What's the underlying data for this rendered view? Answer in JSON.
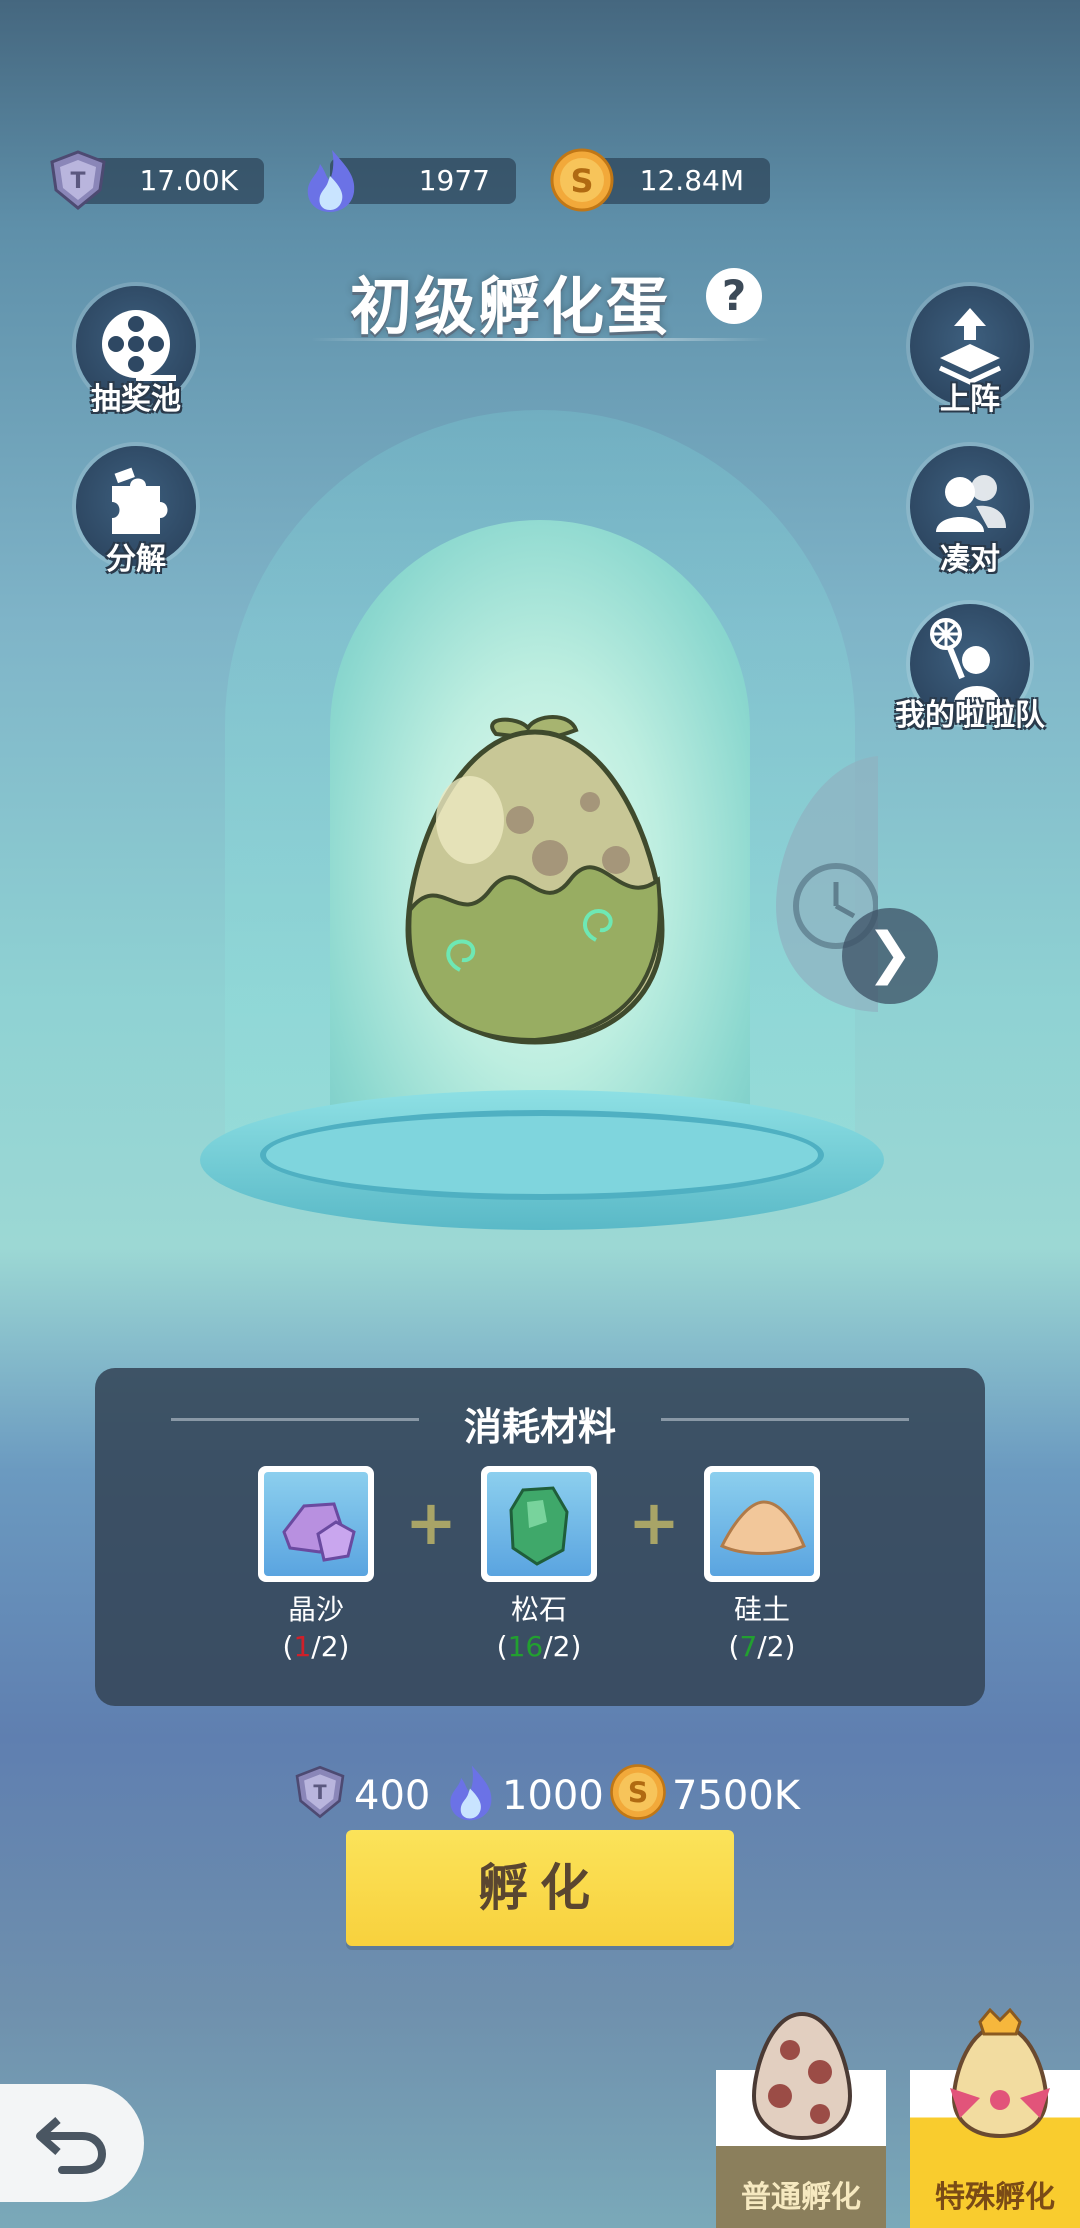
{
  "resources": {
    "gems": "17.00K",
    "fire": "1977",
    "coins": "12.84M"
  },
  "title": "初级孵化蛋",
  "help_symbol": "?",
  "side_buttons": {
    "left": [
      "抽奖池",
      "分解"
    ],
    "right": [
      "上阵",
      "凑对",
      "我的啦啦队"
    ]
  },
  "materials": {
    "title": "消耗材料",
    "items": [
      {
        "name": "晶沙",
        "have": "1",
        "need": "/2)",
        "open": "(",
        "have_color": "#d0202a"
      },
      {
        "name": "松石",
        "have": "16",
        "need": "/2)",
        "open": "(",
        "have_color": "#22a030"
      },
      {
        "name": "硅土",
        "have": "7",
        "need": "/2)",
        "open": "(",
        "have_color": "#22a030"
      }
    ],
    "plus": "+"
  },
  "cost": {
    "gems": "400",
    "fire": "1000",
    "coins": "7500K"
  },
  "hatch_button": "孵化",
  "tabs": {
    "normal": "普通孵化",
    "special": "特殊孵化"
  },
  "colors": {
    "hatch_yellow": "#f8d13d",
    "tab_normal": "#8b7f5c",
    "tab_special": "#f9cc2e"
  }
}
